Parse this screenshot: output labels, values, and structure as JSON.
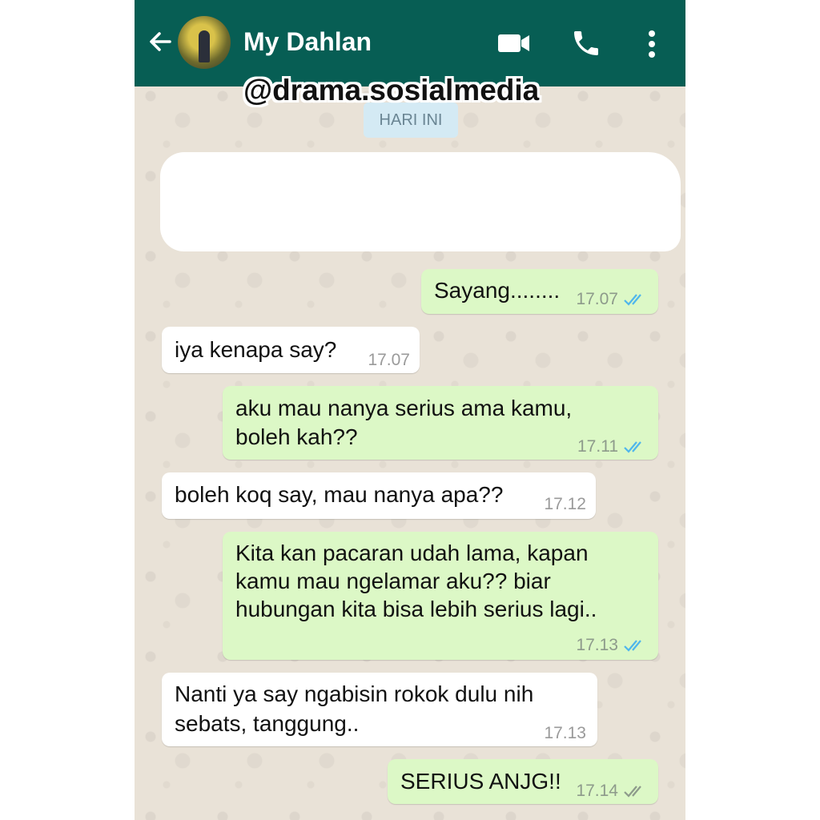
{
  "header": {
    "contact_name": "My Dahlan",
    "colors": {
      "bar": "#075e54",
      "icon": "#ffffff"
    },
    "icons": [
      "back-arrow-icon",
      "avatar",
      "video-call-icon",
      "voice-call-icon",
      "more-vert-icon"
    ]
  },
  "watermark": "@drama.sosialmedia",
  "date_chip": "HARI INI",
  "messages": [
    {
      "direction": "out",
      "lines": [
        "Sayang........"
      ],
      "time": "17.07",
      "status": "read"
    },
    {
      "direction": "in",
      "lines": [
        "iya kenapa say?"
      ],
      "time": "17.07"
    },
    {
      "direction": "out",
      "lines": [
        "aku mau nanya serius ama kamu,",
        "boleh kah??"
      ],
      "time": "17.11",
      "status": "read"
    },
    {
      "direction": "in",
      "lines": [
        "boleh koq say, mau nanya apa??"
      ],
      "time": "17.12"
    },
    {
      "direction": "out",
      "lines": [
        "Kita kan pacaran udah lama, kapan",
        "kamu mau ngelamar aku?? biar",
        "hubungan kita bisa lebih serius lagi.."
      ],
      "time": "17.13",
      "status": "read"
    },
    {
      "direction": "in",
      "lines": [
        "Nanti ya say ngabisin rokok dulu nih",
        "sebats, tanggung.."
      ],
      "time": "17.13"
    },
    {
      "direction": "out",
      "lines": [
        "SERIUS ANJG!!"
      ],
      "time": "17.14",
      "status": "delivered"
    }
  ],
  "colors": {
    "outgoing_bubble": "#dcf8c6",
    "incoming_bubble": "#ffffff",
    "read_tick": "#4fb6ec",
    "delivered_tick": "#8d9a8b"
  }
}
